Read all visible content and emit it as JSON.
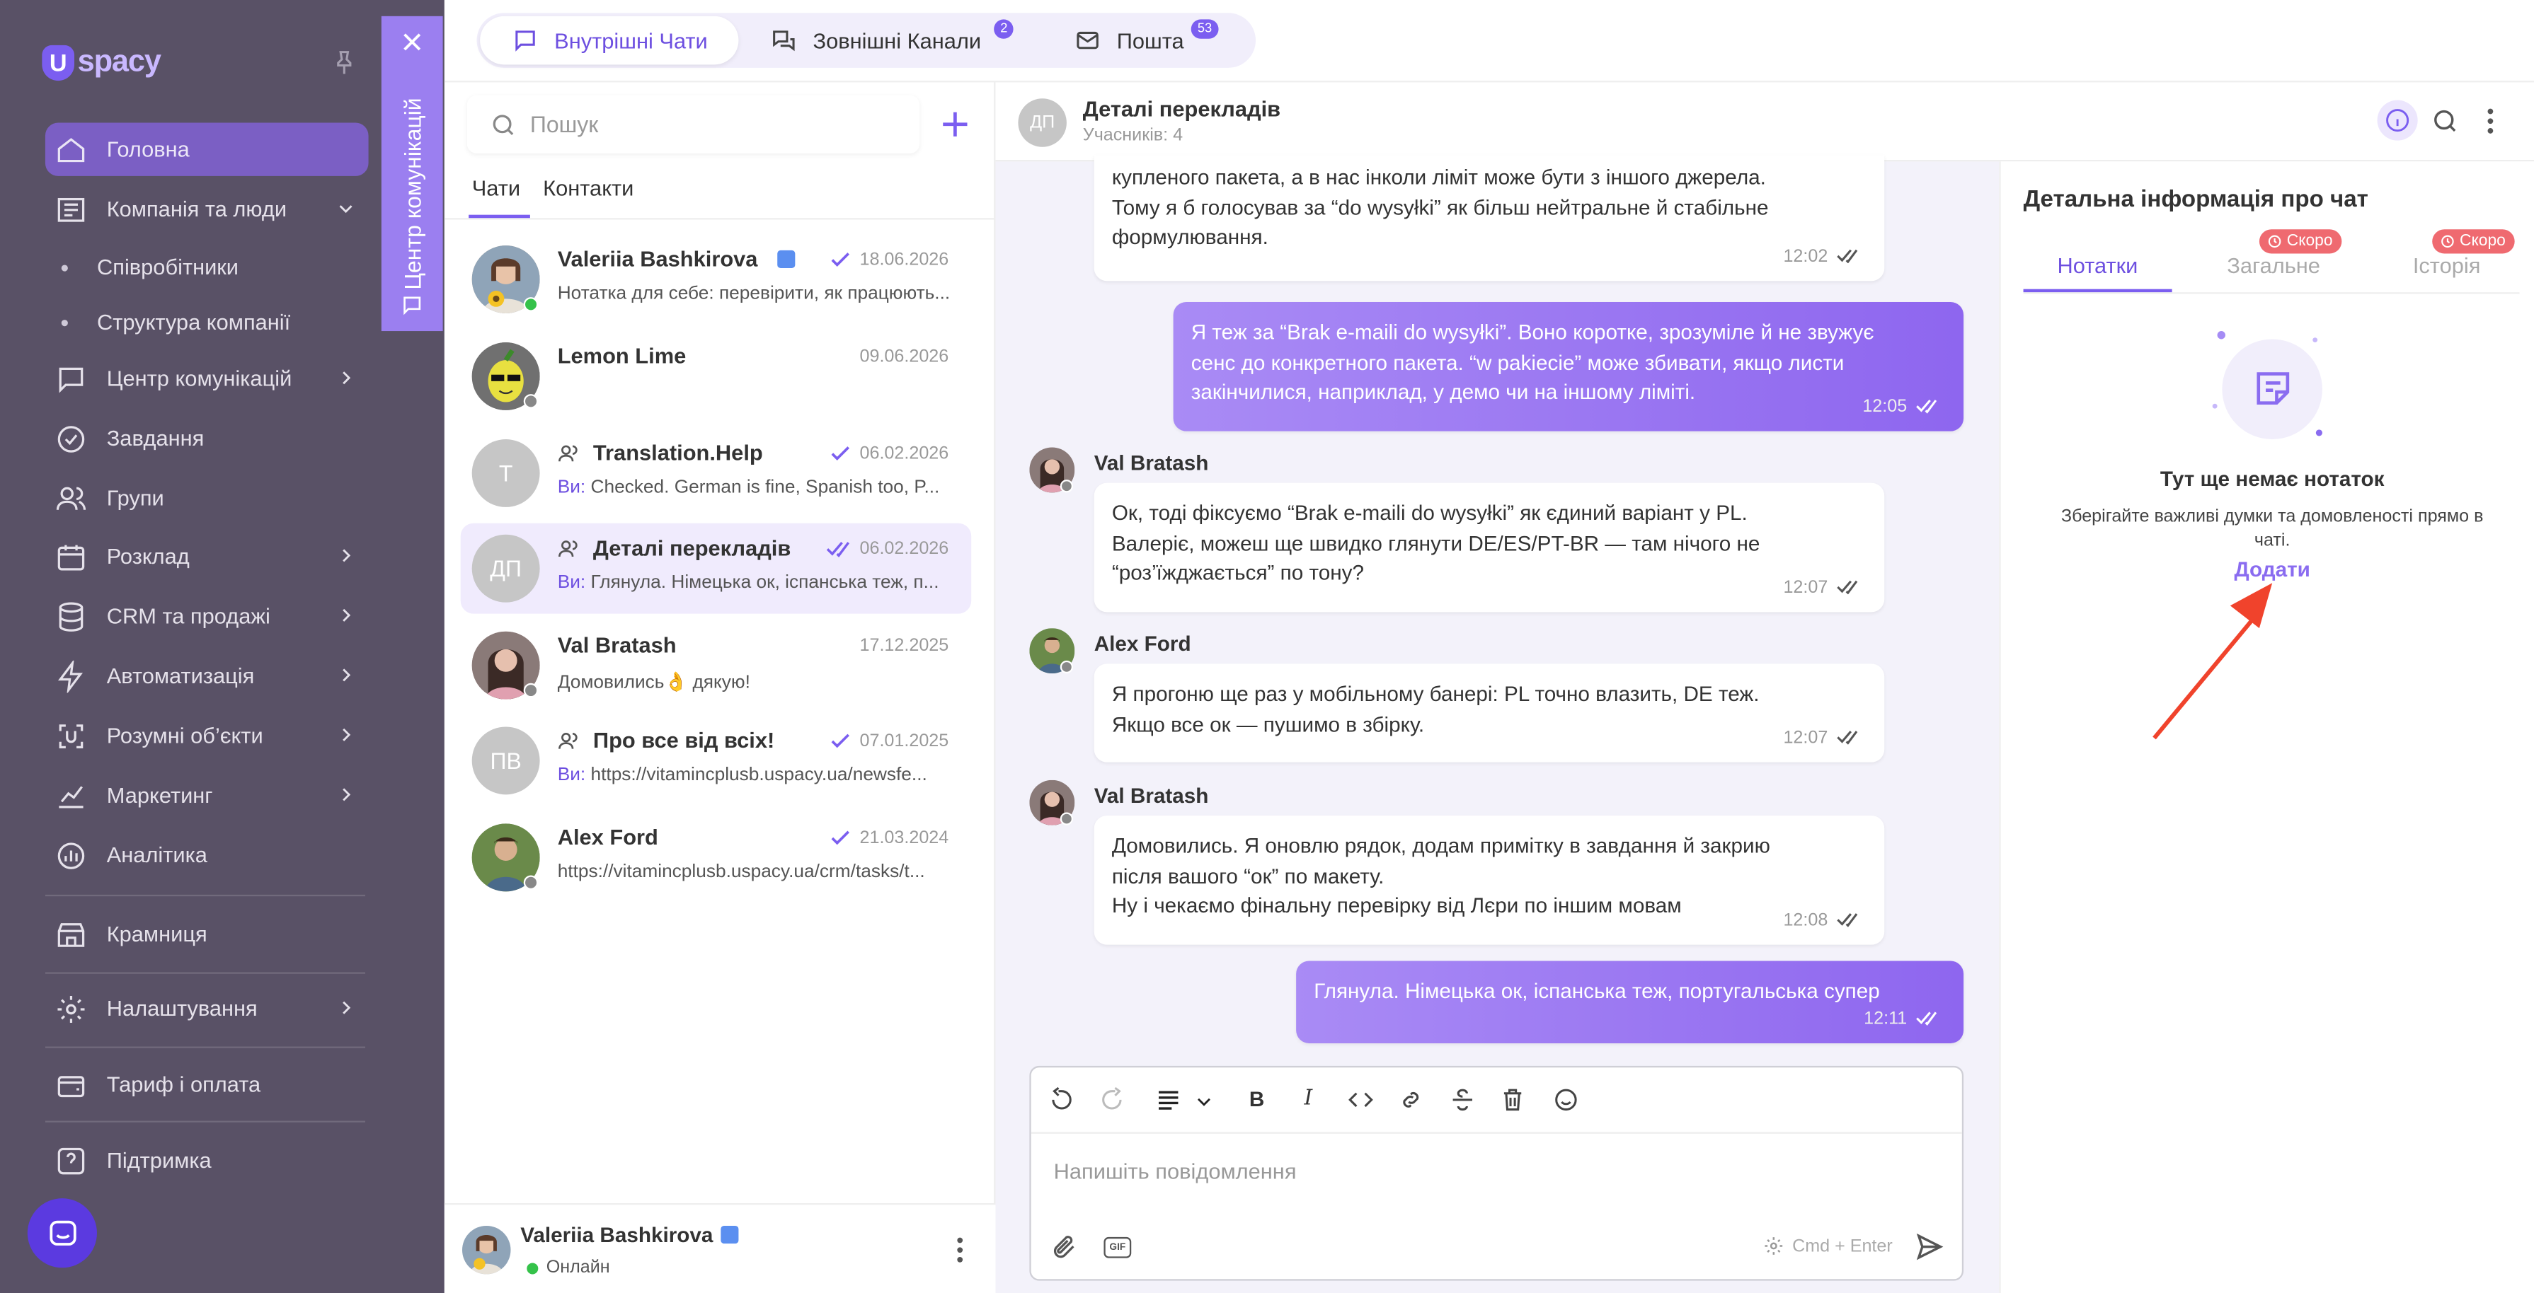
{
  "sidebar": {
    "logo": "spacy",
    "items": [
      {
        "label": "Головна",
        "icon": "home-icon"
      },
      {
        "label": "Компанія та люди",
        "icon": "building-icon"
      },
      {
        "label": "Центр комунікацій",
        "icon": "chat-icon"
      },
      {
        "label": "Завдання",
        "icon": "check-circle-icon"
      },
      {
        "label": "Групи",
        "icon": "users-icon"
      },
      {
        "label": "Розклад",
        "icon": "calendar-icon"
      },
      {
        "label": "CRM та продажі",
        "icon": "database-icon"
      },
      {
        "label": "Автоматизація",
        "icon": "bolt-icon"
      },
      {
        "label": "Розумні об’єкти",
        "icon": "smart-object-icon"
      },
      {
        "label": "Маркетинг",
        "icon": "marketing-icon"
      },
      {
        "label": "Аналітика",
        "icon": "analytics-icon"
      },
      {
        "label": "Крамниця",
        "icon": "store-icon"
      },
      {
        "label": "Налаштування",
        "icon": "gear-icon"
      },
      {
        "label": "Тариф і оплата",
        "icon": "wallet-icon"
      },
      {
        "label": "Підтримка",
        "icon": "help-icon"
      }
    ],
    "subitems": [
      "Співробітники",
      "Структура компанії"
    ]
  },
  "comm_tab": {
    "label": "Центр комунікацій"
  },
  "top_tabs": [
    {
      "label": "Внутрішні Чати",
      "badge": ""
    },
    {
      "label": "Зовнішні Канали",
      "badge": "2"
    },
    {
      "label": "Пошта",
      "badge": "53"
    }
  ],
  "chat_list": {
    "search_placeholder": "Пошук",
    "tabs": [
      "Чати",
      "Контакти"
    ],
    "you_prefix": "Ви:",
    "chats": [
      {
        "name": "Valeriia Bashkirova",
        "date": "18.06.2026",
        "preview": "Нотатка для себе: перевірити, як працюють...",
        "initials": "",
        "status_color": "#35c24a"
      },
      {
        "name": "Lemon Lime",
        "date": "09.06.2026",
        "preview": "",
        "initials": "",
        "status_color": "#888888"
      },
      {
        "name": "Translation.Help",
        "date": "06.02.2026",
        "preview": "Checked. German is fine, Spanish too, P...",
        "initials": "T"
      },
      {
        "name": "Деталі перекладів",
        "date": "06.02.2026",
        "preview": "Глянула. Німецька ок, іспанська теж, п...",
        "initials": "ДП"
      },
      {
        "name": "Val Bratash",
        "date": "17.12.2025",
        "preview": "Домовились👌 дякую!",
        "initials": "",
        "status_color": "#888888"
      },
      {
        "name": "Про все від всіх!",
        "date": "07.01.2025",
        "preview": "https://vitamincplusb.uspacy.ua/newsfe...",
        "initials": "ПВ"
      },
      {
        "name": "Alex Ford",
        "date": "21.03.2024",
        "preview": "https://vitamincplusb.uspacy.ua/crm/tasks/t...",
        "initials": "",
        "status_color": "#888888"
      }
    ],
    "me": {
      "name": "Valeriia Bashkirova",
      "status": "Онлайн"
    }
  },
  "chat": {
    "title": "Деталі перекладів",
    "subtitle": "Учасників: 4",
    "initials": "ДП",
    "messages": [
      {
        "lines": [
          "купленого пакета, а в нас інколи ліміт може бути з іншого джерела.",
          "Тому я б голосував за “do wysyłki” як більш нейтральне й стабільне",
          "формулювання."
        ],
        "time": "12:02"
      },
      {
        "lines": [
          "Я теж за “Brak e-maili do wysyłki”. Воно коротке, зрозуміле й не звужує",
          "сенс до конкретного пакета. “w pakiecie” може збивати, якщо листи",
          "закінчилися, наприклад, у демо чи на іншому ліміті."
        ],
        "time": "12:05"
      },
      {
        "sender": "Val Bratash",
        "lines": [
          "Ок, тоді фіксуємо “Brak e-maili do wysyłki” як єдиний варіант у PL.",
          "Валеріє, можеш ще швидко глянути DE/ES/PT-BR — там нічого не",
          "“роз’їжджається” по тону?"
        ],
        "time": "12:07"
      },
      {
        "sender": "Alex Ford",
        "lines": [
          "Я прогоню ще раз у мобільному банері: PL точно влазить, DE теж.",
          "Якщо все ок — пушимо в збірку."
        ],
        "time": "12:07"
      },
      {
        "sender": "Val Bratash",
        "lines": [
          "Домовились. Я оновлю рядок, додам примітку в завдання й закрию",
          "після вашого “ок” по макету.",
          "Ну і чекаємо фінальну перевірку від Лєри по іншим мовам"
        ],
        "time": "12:08"
      },
      {
        "lines": [
          "Глянула. Німецька ок, іспанська теж, португальська супер"
        ],
        "time": "12:11"
      }
    ],
    "composer_placeholder": "Напишіть повідомлення",
    "shortcut": "Cmd + Enter",
    "gif_label": "GIF"
  },
  "details": {
    "title": "Детальна інформація про чат",
    "tabs": [
      "Нотатки",
      "Загальне",
      "Історія"
    ],
    "soon_label": "Скоро",
    "empty_title": "Тут ще немає нотаток",
    "empty_desc_1": "Зберігайте важливі думки та домовленості прямо в",
    "empty_desc_2": "чаті.",
    "add_label": "Додати"
  },
  "colors": {
    "accent": "#7b5ef0",
    "sidebar": "#595166",
    "soon": "#ef6a70",
    "arrow": "#f0432c"
  }
}
